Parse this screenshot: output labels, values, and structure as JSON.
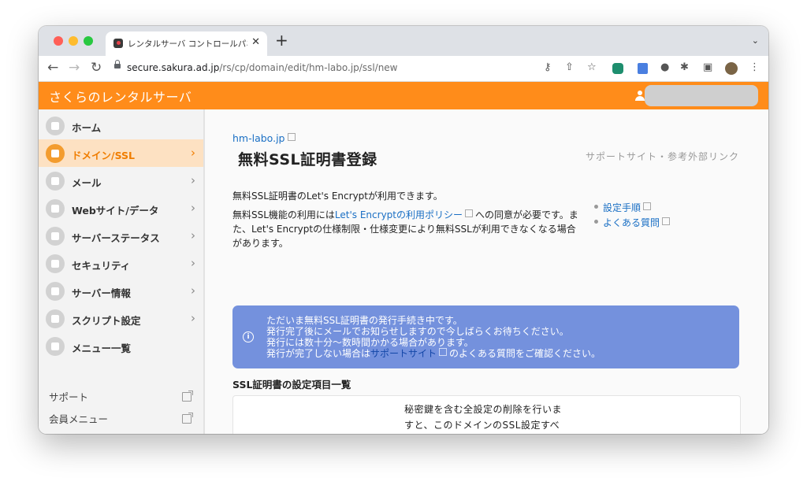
{
  "browser": {
    "tab_title": "レンタルサーバ コントロールパネル",
    "tab_close": "✕",
    "new_tab": "+",
    "tab_menu": "⌄",
    "url_host": "secure.sakura.ad.jp",
    "url_path": "/rs/cp/domain/edit/hm-labo.jp/ssl/new",
    "nav_back": "←",
    "nav_forward": "→",
    "nav_reload": "↻",
    "icons": [
      "key-icon",
      "share-icon",
      "star-icon",
      "extension-green-icon",
      "translate-icon",
      "microphone-icon",
      "puzzle-icon",
      "sidepanel-icon",
      "profile-avatar",
      "more-vert-icon"
    ]
  },
  "header": {
    "brand": "さくらのレンタルサーバ",
    "accent_color": "#ff8c1a"
  },
  "sidebar": {
    "items": [
      {
        "label": "ホーム",
        "icon": "home-icon",
        "active": false,
        "chevron": ""
      },
      {
        "label": "ドメイン/SSL",
        "icon": "domain-icon",
        "active": true,
        "chevron": "›"
      },
      {
        "label": "メール",
        "icon": "mail-icon",
        "active": false,
        "chevron": "›"
      },
      {
        "label": "Webサイト/データ",
        "icon": "globe-icon",
        "active": false,
        "chevron": "›"
      },
      {
        "label": "サーバーステータス",
        "icon": "chart-icon",
        "active": false,
        "chevron": "›"
      },
      {
        "label": "セキュリティ",
        "icon": "lock-icon",
        "active": false,
        "chevron": "›"
      },
      {
        "label": "サーバー情報",
        "icon": "server-icon",
        "active": false,
        "chevron": "›"
      },
      {
        "label": "スクリプト設定",
        "icon": "script-icon",
        "active": false,
        "chevron": "›"
      },
      {
        "label": "メニュー一覧",
        "icon": "list-icon",
        "active": false,
        "chevron": ""
      }
    ],
    "links": [
      {
        "label": "サポート"
      },
      {
        "label": "会員メニュー"
      }
    ]
  },
  "main": {
    "domain_link": "hm-labo.jp",
    "title": "無料SSL証明書登録",
    "support_heading": "サポートサイト・参考外部リンク",
    "support_links": [
      "設定手順",
      "よくある質問"
    ],
    "intro_line1": "無料SSL証明書のLet's Encryptが利用できます。",
    "intro_p2_before": "無料SSL機能の利用には",
    "intro_p2_link": "Let's Encryptの利用ポリシー",
    "intro_p2_after": "への同意が必要です。また、Let's Encryptの仕様制限・仕様変更により無料SSLが利用できなくなる場合があります。",
    "notice": {
      "icon": "i",
      "line1": "ただいま無料SSL証明書の発行手続き中です。",
      "line2": "発行完了後にメールでお知らせしますので今しばらくお待ちください。",
      "line3": "発行には数十分～数時間かかる場合があります。",
      "line4_before": "発行が完了しない場合は",
      "line4_link": "サポートサイト",
      "line4_after": "のよくある質問をご確認ください。",
      "color": "#7491dd"
    },
    "section_heading": "SSL証明書の設定項目一覧",
    "card_text": "秘密鍵を含む全設定の削除を行いますと、このドメインのSSL設定すべてが削除されます。次ページの案内をよくご確認の上、作業を"
  }
}
